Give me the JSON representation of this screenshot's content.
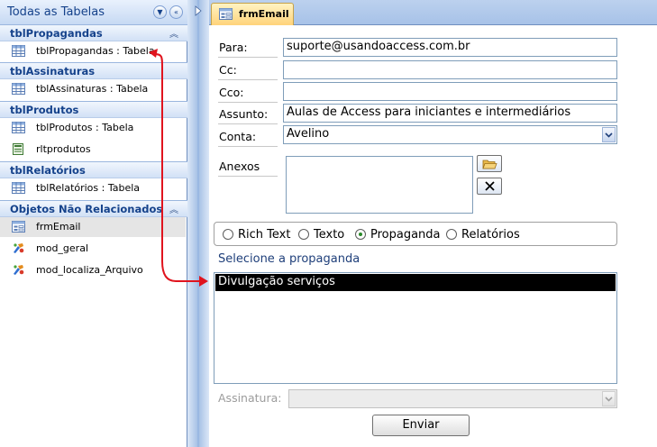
{
  "nav": {
    "title": "Todas as Tabelas",
    "groups": [
      {
        "title": "tblPropagandas",
        "items": [
          {
            "label": "tblPropagandas : Tabela",
            "icon": "table-icon"
          }
        ]
      },
      {
        "title": "tblAssinaturas",
        "items": [
          {
            "label": "tblAssinaturas : Tabela",
            "icon": "table-icon"
          }
        ]
      },
      {
        "title": "tblProdutos",
        "items": [
          {
            "label": "tblProdutos : Tabela",
            "icon": "table-icon"
          },
          {
            "label": "rltprodutos",
            "icon": "report-icon"
          }
        ]
      },
      {
        "title": "tblRelatórios",
        "items": [
          {
            "label": "tblRelatórios : Tabela",
            "icon": "table-icon"
          }
        ]
      },
      {
        "title": "Objetos Não Relacionados",
        "items": [
          {
            "label": "frmEmail",
            "icon": "form-icon",
            "selected": true
          },
          {
            "label": "mod_geral",
            "icon": "module-icon"
          },
          {
            "label": "mod_localiza_Arquivo",
            "icon": "module-icon"
          }
        ]
      }
    ]
  },
  "tab": {
    "label": "frmEmail"
  },
  "form": {
    "para_label": "Para:",
    "para_value": "suporte@usandoaccess.com.br",
    "cc_label": "Cc:",
    "cc_value": "",
    "cco_label": "Cco:",
    "cco_value": "",
    "assunto_label": "Assunto:",
    "assunto_value": "Aulas de Access para iniciantes e intermediários",
    "conta_label": "Conta:",
    "conta_value": "Avelino",
    "anexos_label": "Anexos",
    "radios": [
      {
        "label": "Rich Text",
        "checked": false
      },
      {
        "label": "Texto",
        "checked": false
      },
      {
        "label": "Propaganda",
        "checked": true
      },
      {
        "label": "Relatórios",
        "checked": false
      }
    ],
    "select_label": "Selecione a propaganda",
    "list_items": [
      "Divulgação serviços"
    ],
    "assinatura_label": "Assinatura:",
    "assinatura_value": "",
    "send_label": "Enviar"
  },
  "colors": {
    "annotation_arrow": "#e0141e",
    "tab_active": "#ffd37a",
    "nav_header_text": "#15428b"
  }
}
